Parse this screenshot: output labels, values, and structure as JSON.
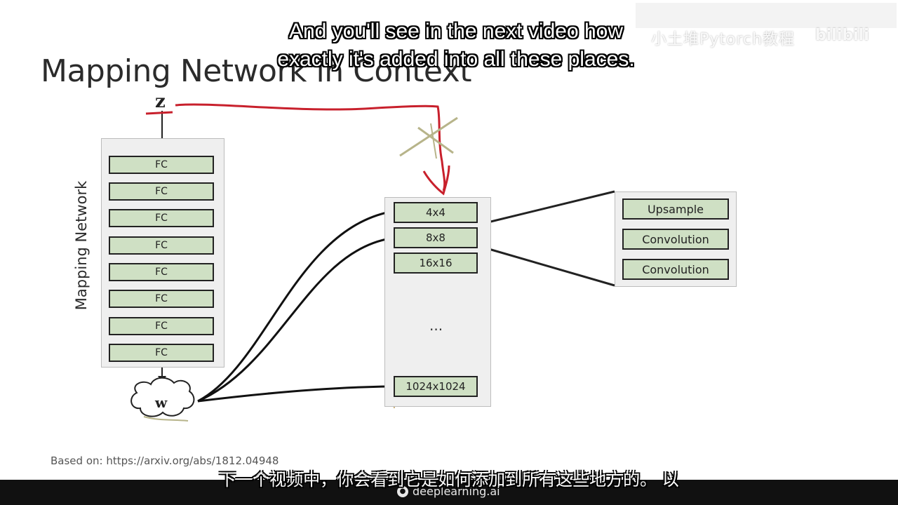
{
  "slide": {
    "title": "Mapping Network in Context"
  },
  "mapping_network": {
    "label": "Mapping Network",
    "input": "z",
    "output": "w",
    "layers": [
      "FC",
      "FC",
      "FC",
      "FC",
      "FC",
      "FC",
      "FC",
      "FC"
    ]
  },
  "synthesis_network": {
    "blocks": [
      "4x4",
      "8x8",
      "16x16",
      "1024x1024"
    ],
    "ellipsis": "..."
  },
  "block_detail": {
    "ops": [
      "Upsample",
      "Convolution",
      "Convolution"
    ]
  },
  "source_note": "Based on: https://arxiv.org/abs/1812.04948",
  "captions": {
    "english_line1": "And you'll see in the next video how",
    "english_line2": "exactly it's added into all these places.",
    "chinese": "下一个视频中，你会看到它是如何添加到所有这些地方的。 以"
  },
  "brand": {
    "name": "deeplearning.ai"
  },
  "watermark": {
    "text": "小土堆Pytorch教程",
    "logo": "bilibili"
  },
  "colors": {
    "block_fill": "#cfe0c4",
    "annotation_red": "#c8202c",
    "annotation_cross": "#b7b48a"
  },
  "icons": {
    "brand": "deeplearning-logo-icon"
  }
}
